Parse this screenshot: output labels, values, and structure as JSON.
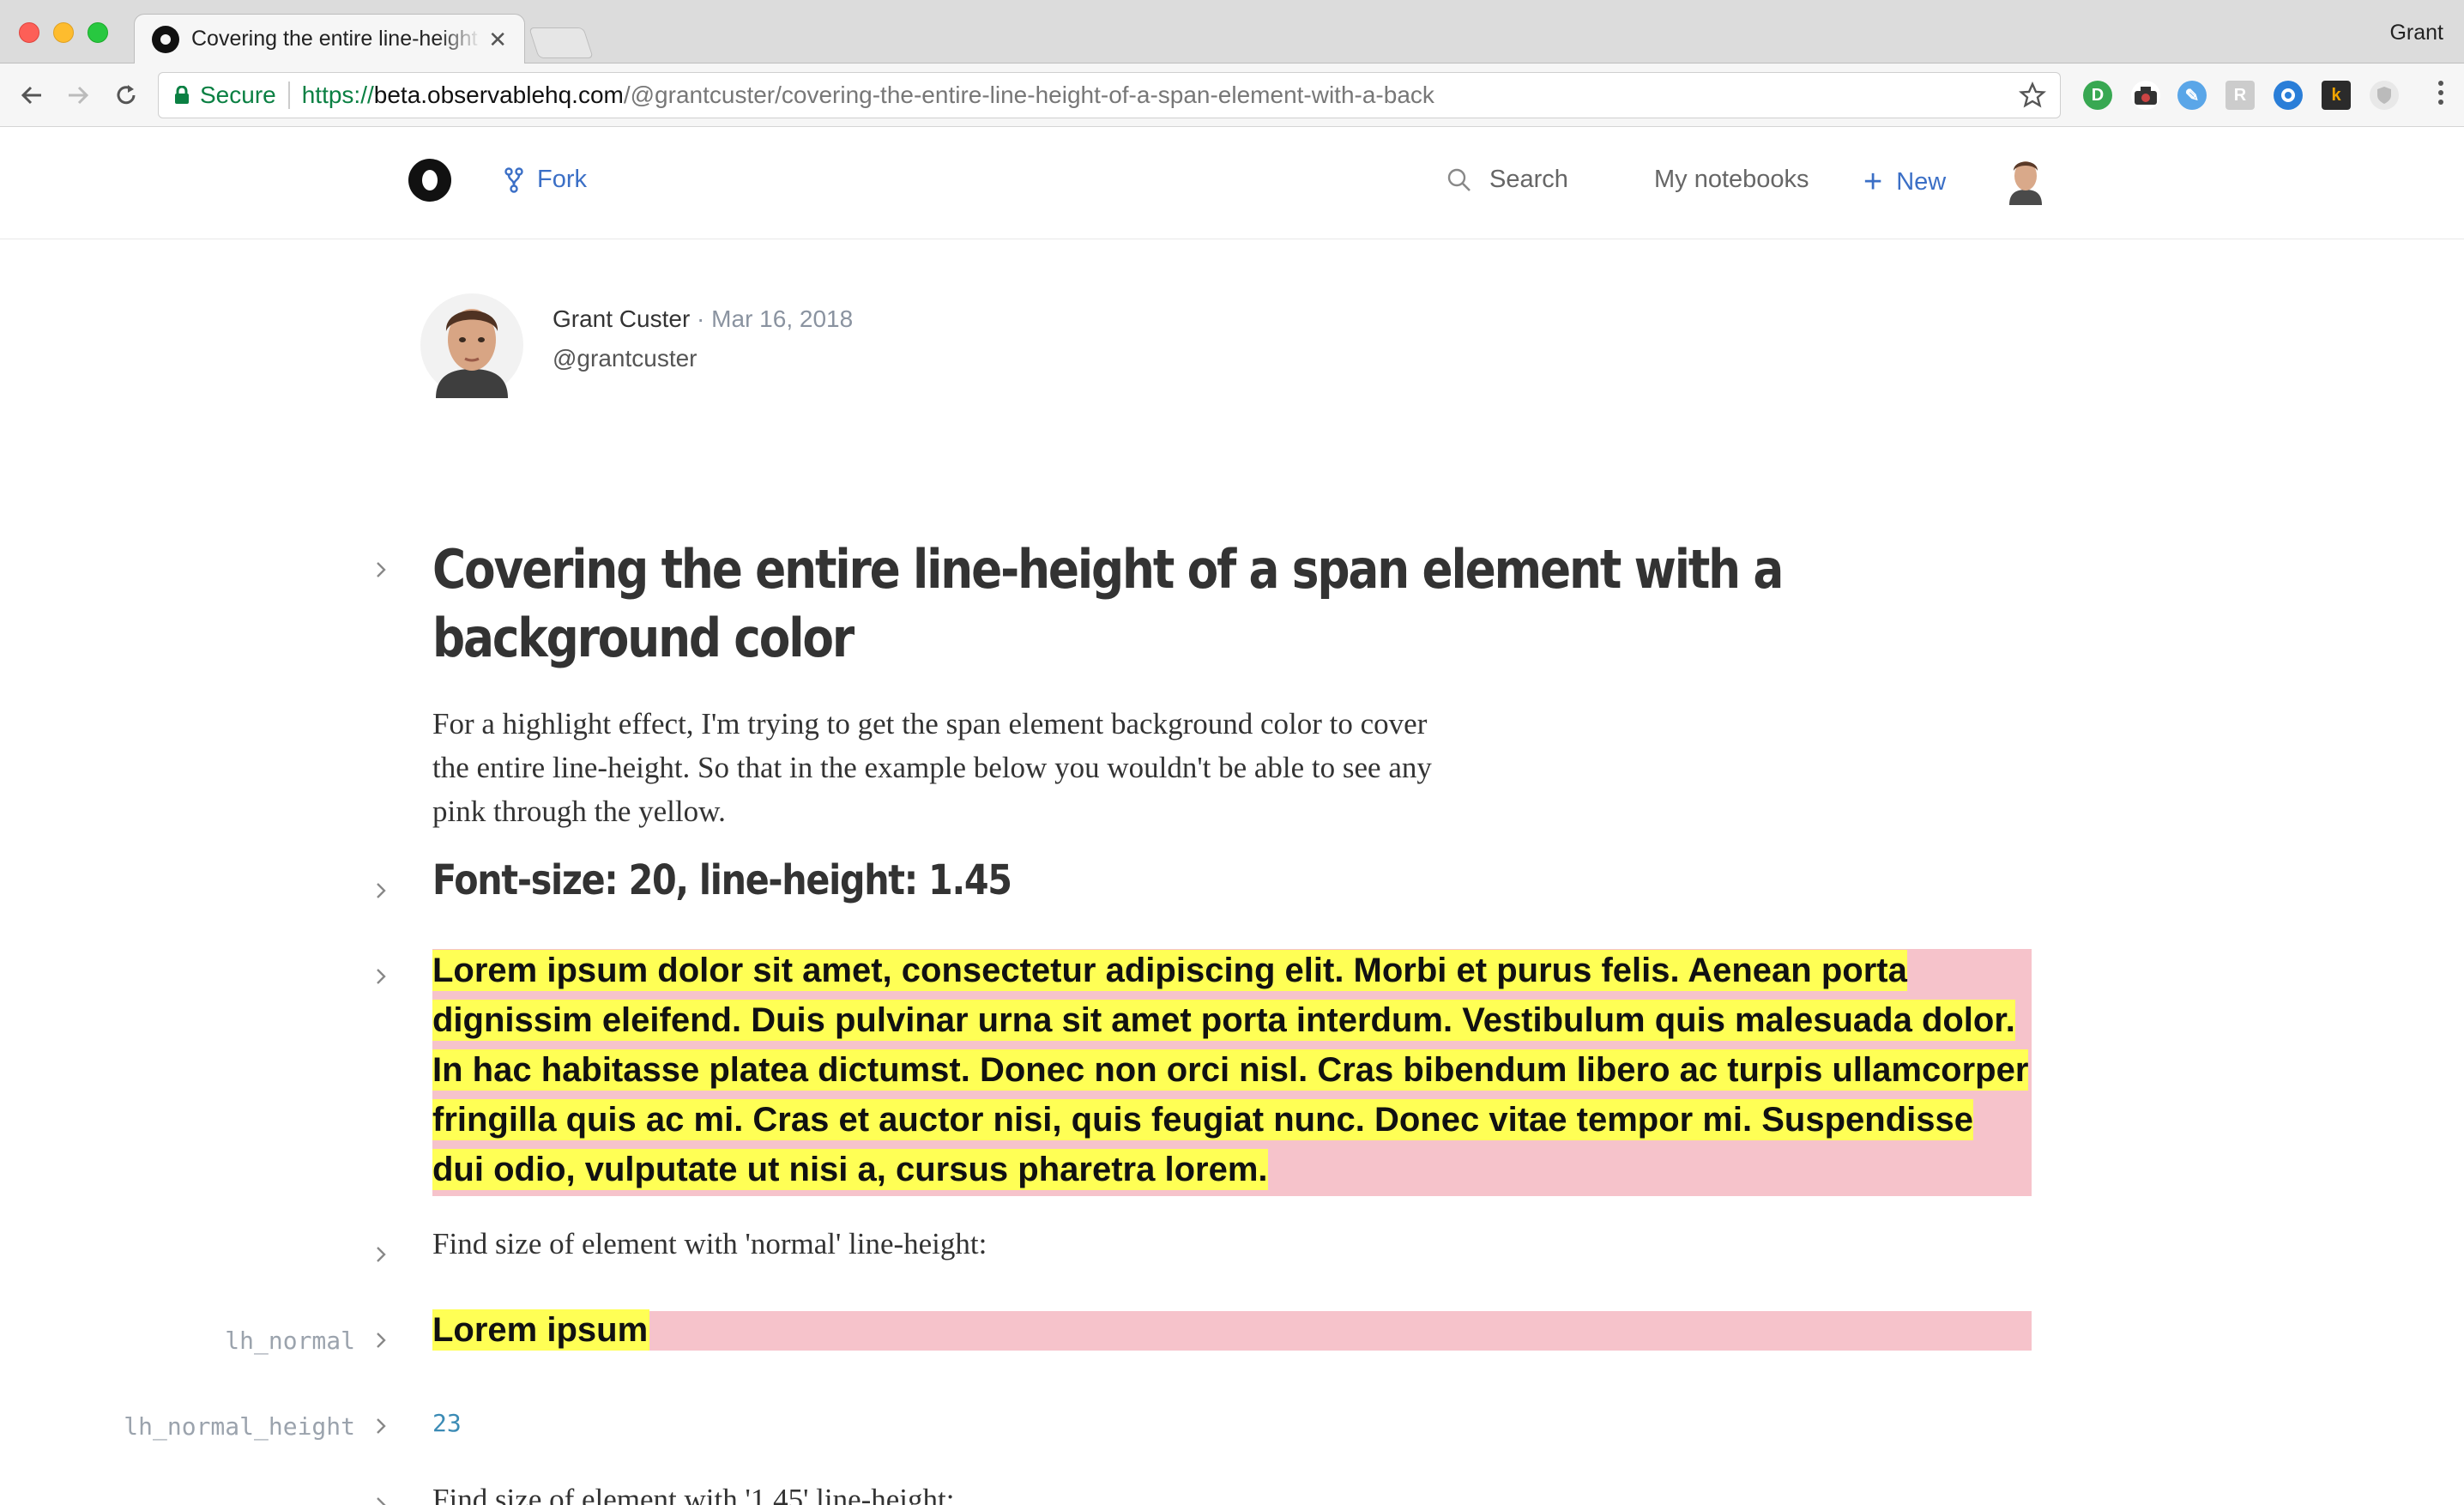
{
  "browser": {
    "tab_title": "Covering the entire line-height of a span element with a background color",
    "profile_name": "Grant",
    "secure_label": "Secure",
    "url_scheme": "https://",
    "url_host": "beta.observablehq.com",
    "url_path": "/@grantcuster/covering-the-entire-line-height-of-a-span-element-with-a-back"
  },
  "header": {
    "fork_label": "Fork",
    "search_label": "Search",
    "notebooks_label": "My notebooks",
    "new_label": "New"
  },
  "author": {
    "name": "Grant Custer",
    "separator": " · ",
    "date": "Mar 16, 2018",
    "handle": "@grantcuster"
  },
  "notebook": {
    "title": "Covering the entire line-height of a span element with a background color",
    "intro_lines": [
      "For a highlight effect, I'm trying to get the span element background color to cover",
      "the entire line-height. So that in the example below you wouldn't be able to see any",
      "pink through the yellow."
    ],
    "heading": "Font-size: 20, line-height: 1.45",
    "highlight_lines": [
      "Lorem ipsum dolor sit amet, consectetur adipiscing elit. Morbi et purus felis. Aenean porta",
      "dignissim eleifend. Duis pulvinar urna sit amet porta interdum. Vestibulum quis malesuada dolor.",
      "In hac habitasse platea dictumst. Donec non orci nisl. Cras bibendum libero ac turpis ullamcorper",
      "fringilla quis ac mi. Cras et auctor nisi, quis feugiat nunc. Donec vitae tempor mi. Suspendisse",
      "dui odio, vulputate ut nisi a, cursus pharetra lorem."
    ],
    "find_normal_text": "Find size of element with 'normal' line-height:",
    "lh_normal_label": "lh_normal",
    "lorem_small": "Lorem ipsum",
    "lh_normal_height_label": "lh_normal_height",
    "lh_normal_height_value": "23",
    "find_145_text": "Find size of element with '1.45' line-height:"
  },
  "colors": {
    "highlight_yellow": "#ffff55",
    "pink_background": "#f6c3cb",
    "link_blue": "#3b6fc6",
    "secure_green": "#0b8043",
    "value_blue": "#3b8bb5"
  }
}
